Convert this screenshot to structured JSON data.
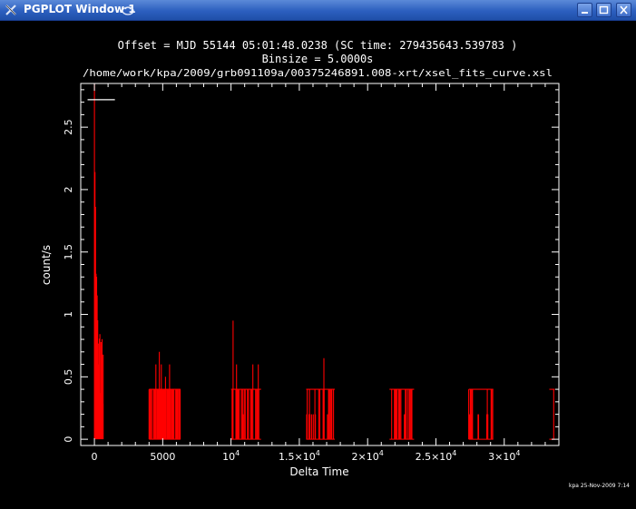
{
  "window": {
    "title": "PGPLOT Window 1",
    "icons": [
      "app-x-icon",
      "sticky-icon",
      "minimize-icon",
      "maximize-icon",
      "close-icon"
    ]
  },
  "colors": {
    "background": "#000000",
    "axes": "#ffffff",
    "data": "#ff0000",
    "titlebar": "#2c5fbf"
  },
  "chart_data": {
    "type": "line",
    "title": "Offset = MJD  55144  05:01:48.0238  (SC time:      279435643.539783 )",
    "subtitle": "Binsize =       5.0000s",
    "file": "/home/work/kpa/2009/grb091109a/00375246891.008-xrt/xsel_fits_curve.xsl",
    "xlabel": "Delta Time",
    "ylabel": "count/s",
    "footer": "kpa 25-Nov-2009  7:14",
    "xlim": [
      -1000,
      34000
    ],
    "ylim": [
      -0.05,
      2.85
    ],
    "x_ticks": [
      {
        "v": 0,
        "label": "0"
      },
      {
        "v": 5000,
        "label": "5000"
      },
      {
        "v": 10000,
        "label": "10",
        "exp": "4"
      },
      {
        "v": 15000,
        "label": "1.5×10",
        "exp": "4"
      },
      {
        "v": 20000,
        "label": "2×10",
        "exp": "4"
      },
      {
        "v": 25000,
        "label": "2.5×10",
        "exp": "4"
      },
      {
        "v": 30000,
        "label": "3×10",
        "exp": "4"
      }
    ],
    "y_ticks": [
      {
        "v": 0,
        "label": "0"
      },
      {
        "v": 0.5,
        "label": "0.5"
      },
      {
        "v": 1,
        "label": "1"
      },
      {
        "v": 1.5,
        "label": "1.5"
      },
      {
        "v": 2,
        "label": "2"
      },
      {
        "v": 2.5,
        "label": "2.5"
      }
    ],
    "error_bar": {
      "x": [
        -500,
        1500
      ],
      "y": 2.72
    },
    "series": [
      {
        "segments": [
          {
            "start": 0,
            "end": 650,
            "bin": 5,
            "pattern": "decay",
            "peak": 2.85
          },
          {
            "start": 4000,
            "end": 6300,
            "bin": 5,
            "pattern": "low",
            "spikes": [
              [
                4500,
                0.6
              ],
              [
                4750,
                0.7
              ],
              [
                4900,
                0.6
              ],
              [
                5200,
                0.5
              ],
              [
                5500,
                0.6
              ]
            ]
          },
          {
            "start": 10000,
            "end": 12200,
            "bin": 5,
            "pattern": "sparse",
            "spikes": [
              [
                10150,
                0.95
              ],
              [
                10400,
                0.6
              ],
              [
                11600,
                0.6
              ],
              [
                12000,
                0.6
              ]
            ]
          },
          {
            "start": 15500,
            "end": 17600,
            "bin": 5,
            "pattern": "sparse",
            "spikes": [
              [
                16800,
                0.65
              ]
            ]
          },
          {
            "start": 21600,
            "end": 23400,
            "bin": 5,
            "pattern": "sparse",
            "spikes": []
          },
          {
            "start": 27400,
            "end": 29200,
            "bin": 5,
            "pattern": "sparse",
            "spikes": []
          },
          {
            "start": 33300,
            "end": 33700,
            "bin": 5,
            "pattern": "sparse",
            "spikes": []
          }
        ]
      }
    ]
  }
}
